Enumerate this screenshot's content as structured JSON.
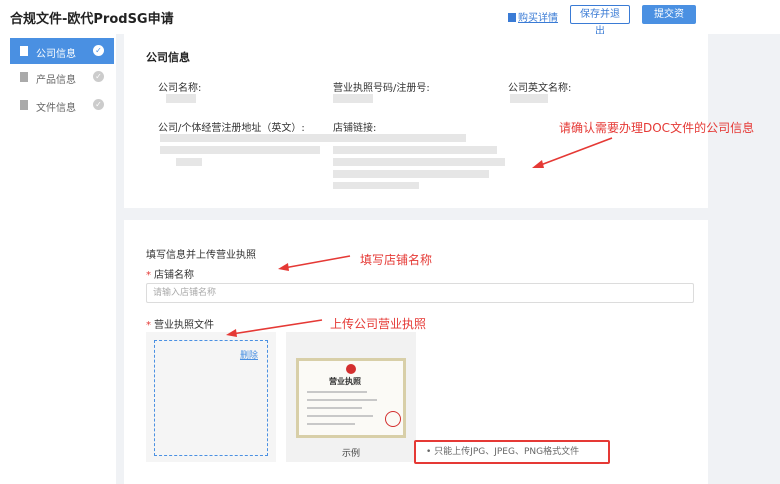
{
  "header": {
    "title": "合规文件-欧代ProdSG申请",
    "buy_link": "购买详情",
    "save_button": "保存并退出",
    "submit_button": "提交资料"
  },
  "sidebar": {
    "items": [
      {
        "label": "公司信息",
        "icon": "document-icon",
        "active": true
      },
      {
        "label": "产品信息",
        "icon": "box-icon",
        "active": false
      },
      {
        "label": "文件信息",
        "icon": "file-icon",
        "active": false
      }
    ]
  },
  "company": {
    "section_title": "公司信息",
    "name_label": "公司名称:",
    "license_label": "营业执照号码/注册号:",
    "english_name_label": "公司英文名称:",
    "address_label": "公司/个体经营注册地址（英文）:",
    "store_link_label": "店铺链接:"
  },
  "form": {
    "section_title": "填写信息并上传营业执照",
    "store_name_label": "店铺名称",
    "store_name_placeholder": "请输入店铺名称",
    "license_file_label": "营业执照文件",
    "delete_link": "删除",
    "sample_caption": "示例",
    "upload_note": "只能上传JPG、JPEG、PNG格式文件",
    "sample_cert_title": "营业执照"
  },
  "annotations": {
    "confirm_company": "请确认需要办理DOC文件的公司信息",
    "fill_store": "填写店铺名称",
    "upload_license": "上传公司营业执照"
  },
  "colors": {
    "primary": "#4a90e2",
    "annotation": "#e53935"
  }
}
